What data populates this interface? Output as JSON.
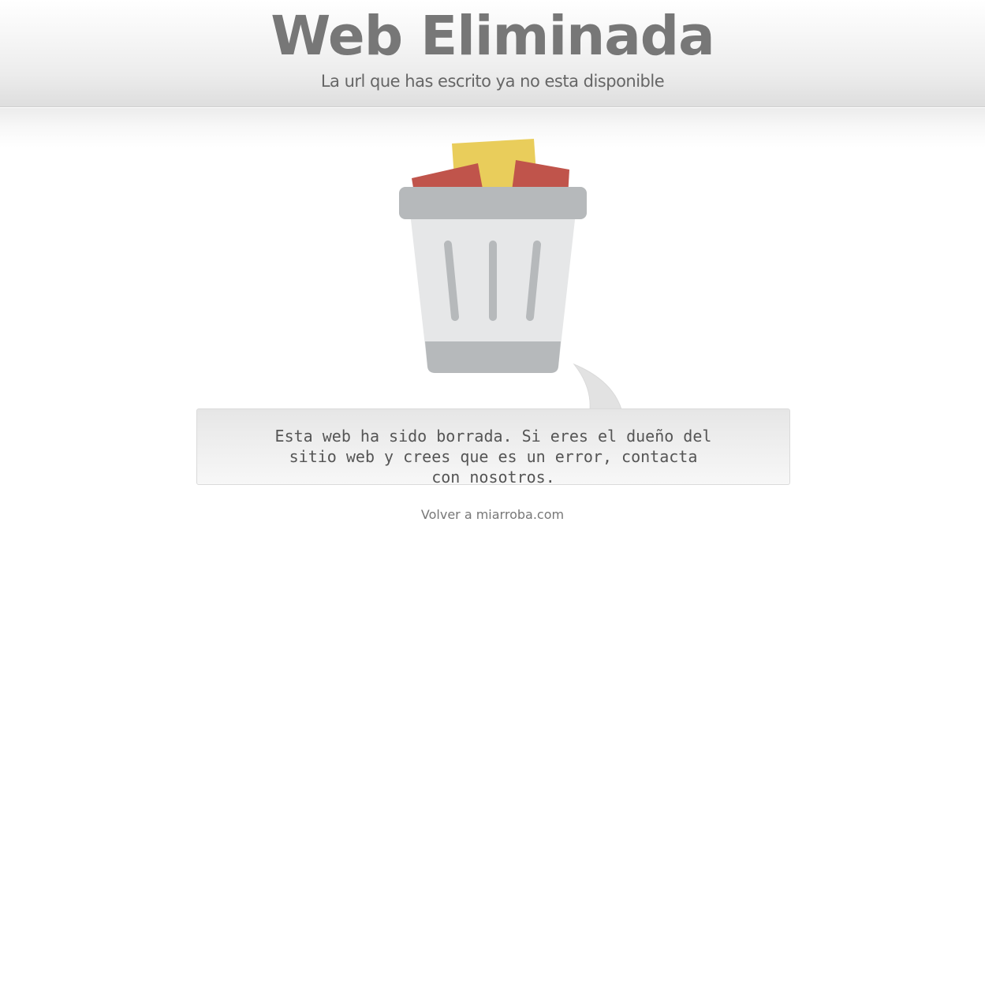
{
  "header": {
    "title": "Web Eliminada",
    "subtitle": "La url que has escrito ya no esta disponible"
  },
  "illustration": {
    "icon": "trash-bin-icon",
    "colors": {
      "paper_yellow": "#e9cd5b",
      "paper_red": "#c0544b",
      "bin_body": "#e6e7e8",
      "bin_lid": "#b6b9bb",
      "bin_stripes": "#b6b9bb"
    }
  },
  "message": {
    "text": "Esta web ha sido borrada. Si eres el dueño del sitio web y crees que es un error, contacta con nosotros."
  },
  "footer": {
    "back_link": "Volver a miarroba.com"
  }
}
